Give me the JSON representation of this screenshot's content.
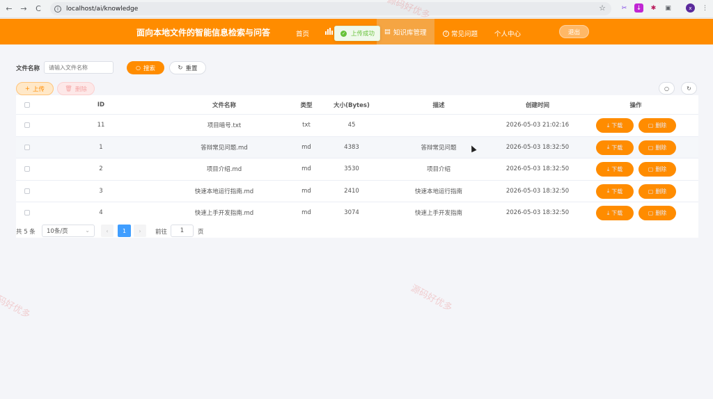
{
  "browser": {
    "url": "localhost/ai/knowledge",
    "back_icon": "←",
    "forward_icon": "→",
    "reload_icon": "C",
    "info_icon": "i",
    "star_icon": "☆",
    "profile_label": "x"
  },
  "header": {
    "title": "面向本地文件的智能信息检索与问答",
    "nav": [
      {
        "label": "首页"
      },
      {
        "label": "知识库管理"
      },
      {
        "label": "常见问题"
      },
      {
        "label": "个人中心"
      }
    ],
    "logout_label": "退出",
    "toast_text": "上传成功"
  },
  "search": {
    "label": "文件名称",
    "placeholder": "请输入文件名称",
    "search_label": "搜索",
    "reset_label": "重置"
  },
  "toolbar": {
    "upload_label": "上传",
    "delete_label": "删除"
  },
  "table": {
    "columns": [
      "ID",
      "文件名称",
      "类型",
      "大小(Bytes)",
      "描述",
      "创建时间",
      "操作"
    ],
    "rows": [
      {
        "id": "11",
        "name": "项目暗号.txt",
        "type": "txt",
        "size": "45",
        "desc": "",
        "created": "2026-05-03 21:02:16"
      },
      {
        "id": "1",
        "name": "答辩常见问题.md",
        "type": "md",
        "size": "4383",
        "desc": "答辩常见问题",
        "created": "2026-05-03 18:32:50"
      },
      {
        "id": "2",
        "name": "项目介绍.md",
        "type": "md",
        "size": "3530",
        "desc": "项目介绍",
        "created": "2026-05-03 18:32:50"
      },
      {
        "id": "3",
        "name": "快速本地运行指南.md",
        "type": "md",
        "size": "2410",
        "desc": "快速本地运行指南",
        "created": "2026-05-03 18:32:50"
      },
      {
        "id": "4",
        "name": "快速上手开发指南.md",
        "type": "md",
        "size": "3074",
        "desc": "快速上手开发指南",
        "created": "2026-05-03 18:32:50"
      }
    ],
    "download_label": "下载",
    "delete_label": "删除"
  },
  "pagination": {
    "total": "共 5 条",
    "page_size": "10条/页",
    "current_page": "1",
    "goto_prefix": "前往",
    "goto_value": "1",
    "goto_suffix": "页"
  },
  "watermark": "源码好优多",
  "colors": {
    "brand": "#ff8c00",
    "success": "#67c23a",
    "page_active": "#409eff"
  }
}
